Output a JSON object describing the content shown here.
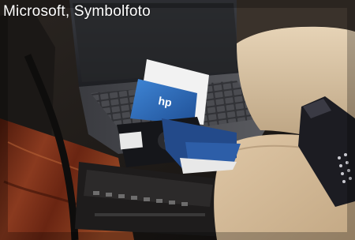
{
  "photo": {
    "caption": "Microsoft, Symbolfoto",
    "subject": "laptop-floppy-disks-car-interior",
    "colors": {
      "wood": "#7a2e18",
      "leather": "#d9c3a4",
      "laptop": "#2c2d31",
      "disk_blue": "#2b69b8",
      "disk_dark": "#1b2a4a"
    }
  }
}
